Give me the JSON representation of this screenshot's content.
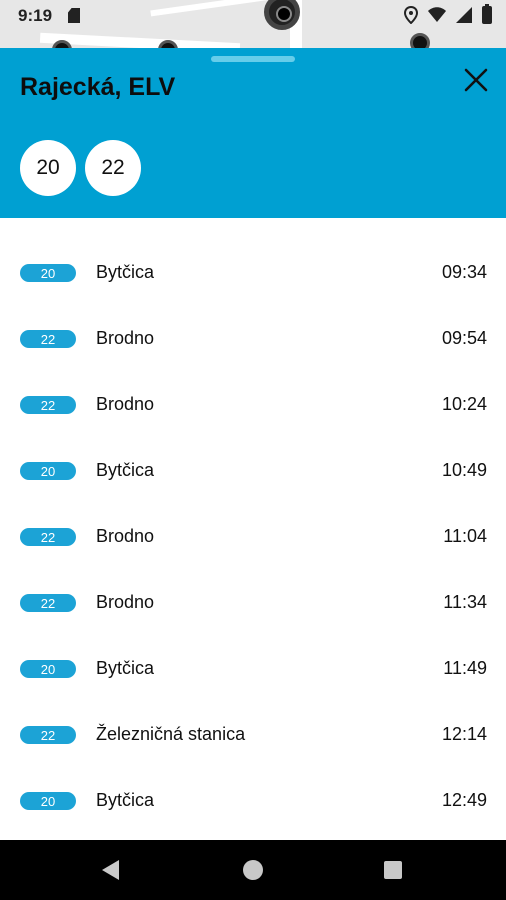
{
  "status_bar": {
    "time": "9:19",
    "icons": [
      "sd-card-icon",
      "location-icon",
      "wifi-icon",
      "signal-icon",
      "battery-icon"
    ]
  },
  "header": {
    "title": "Rajecká, ELV",
    "lines": [
      "20",
      "22"
    ],
    "background_color": "#00a0d2"
  },
  "departures": [
    {
      "line": "20",
      "destination": "Bytčica",
      "time": "09:34"
    },
    {
      "line": "22",
      "destination": "Brodno",
      "time": "09:54"
    },
    {
      "line": "22",
      "destination": "Brodno",
      "time": "10:24"
    },
    {
      "line": "20",
      "destination": "Bytčica",
      "time": "10:49"
    },
    {
      "line": "22",
      "destination": "Brodno",
      "time": "11:04"
    },
    {
      "line": "22",
      "destination": "Brodno",
      "time": "11:34"
    },
    {
      "line": "20",
      "destination": "Bytčica",
      "time": "11:49"
    },
    {
      "line": "22",
      "destination": "Železničná stanica",
      "time": "12:14"
    },
    {
      "line": "20",
      "destination": "Bytčica",
      "time": "12:49"
    }
  ],
  "nav_bar": {
    "buttons": [
      "back-icon",
      "home-icon",
      "recents-icon"
    ]
  }
}
